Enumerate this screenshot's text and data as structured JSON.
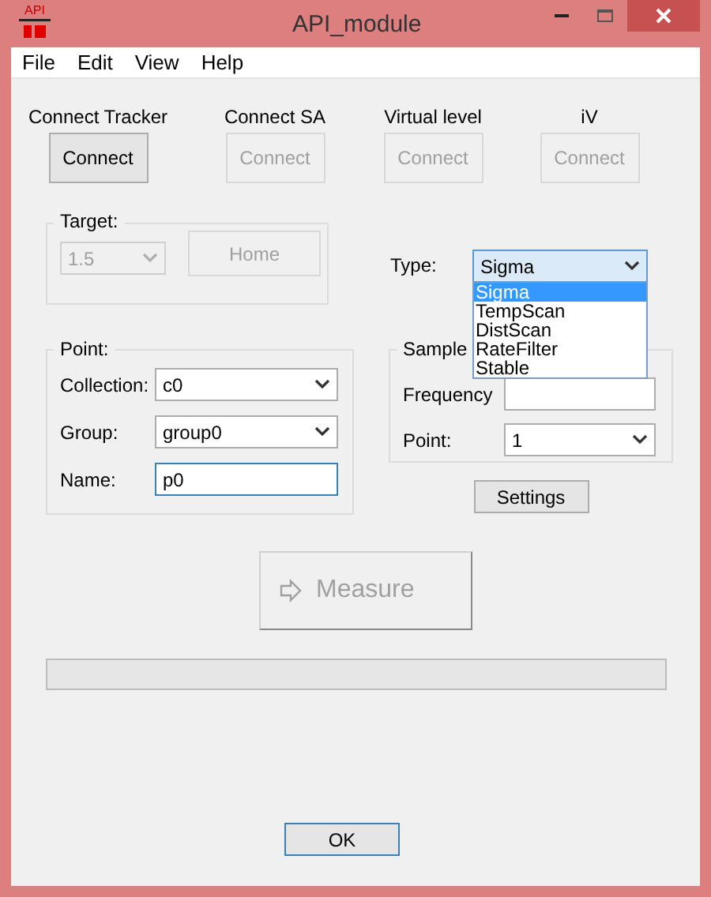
{
  "window": {
    "title": "API_module",
    "logo_text": "API"
  },
  "menu": [
    "File",
    "Edit",
    "View",
    "Help"
  ],
  "connections": [
    {
      "label": "Connect Tracker",
      "button": "Connect",
      "disabled": false
    },
    {
      "label": "Connect SA",
      "button": "Connect",
      "disabled": true
    },
    {
      "label": "Virtual level",
      "button": "Connect",
      "disabled": true
    },
    {
      "label": "iV",
      "button": "Connect",
      "disabled": true
    }
  ],
  "target": {
    "title": "Target:",
    "value": "1.5",
    "disabled": true,
    "button": "Home",
    "button_disabled": true
  },
  "type": {
    "label": "Type:",
    "value": "Sigma",
    "expanded": true,
    "options": [
      {
        "label": "Sigma",
        "selected": true
      },
      {
        "label": "TempScan",
        "selected": false
      },
      {
        "label": "DistScan",
        "selected": false
      },
      {
        "label": "RateFilter",
        "selected": false
      },
      {
        "label": "Stable",
        "selected": false
      }
    ]
  },
  "point": {
    "title": "Point:",
    "fields": [
      {
        "kind": "combo",
        "label": "Collection:",
        "value": "c0"
      },
      {
        "kind": "combo",
        "label": "Group:",
        "value": "group0"
      },
      {
        "kind": "text",
        "label": "Name:",
        "value": "p0",
        "focused": true
      }
    ]
  },
  "sample": {
    "title": "Sample",
    "fields": [
      {
        "kind": "text",
        "label": "Frequency",
        "focused": false
      },
      {
        "kind": "combo",
        "label": "Point:",
        "value": "1"
      }
    ]
  },
  "settings_button": "Settings",
  "measure_button": {
    "label": "Measure",
    "disabled": true
  },
  "progress": {
    "level": 0
  },
  "ok_button": "OK"
}
